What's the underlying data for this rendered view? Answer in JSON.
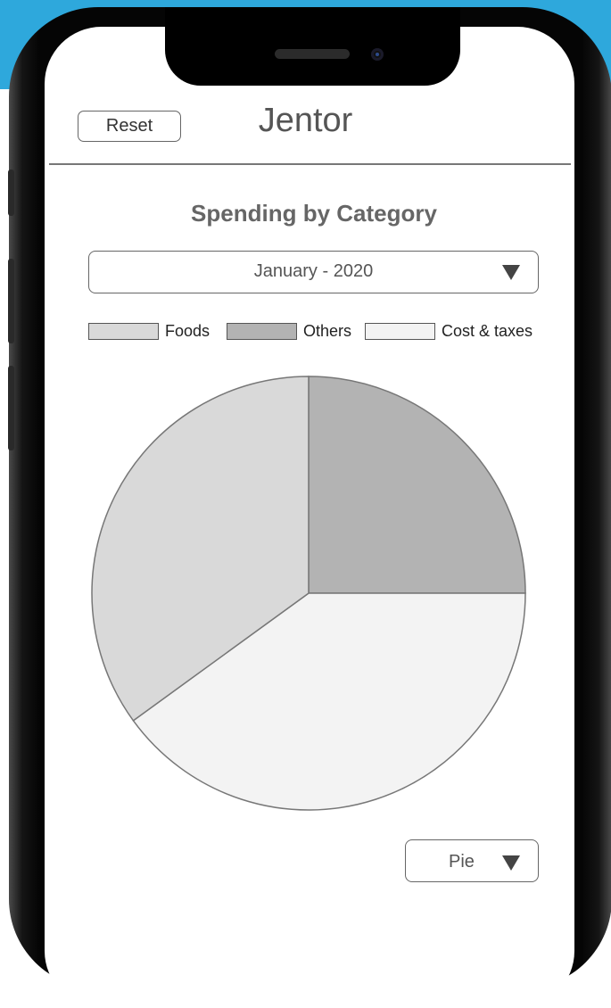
{
  "header": {
    "reset_label": "Reset",
    "app_title": "Jentor"
  },
  "chart_title": "Spending by Category",
  "month_select": {
    "value": "January - 2020",
    "arrow_icon": "triangle-down-icon"
  },
  "legend": [
    {
      "label": "Foods",
      "color": "#d9d9d9"
    },
    {
      "label": "Others",
      "color": "#b3b3b3"
    },
    {
      "label": "Cost & taxes",
      "color": "#f3f3f3"
    }
  ],
  "chart_type_select": {
    "value": "Pie",
    "arrow_icon": "triangle-down-icon"
  },
  "chart_data": {
    "type": "pie",
    "title": "Spending by Category",
    "categories": [
      "Others",
      "Cost & taxes",
      "Foods"
    ],
    "values": [
      25,
      40,
      35
    ],
    "colors": [
      "#b3b3b3",
      "#f3f3f3",
      "#d9d9d9"
    ]
  }
}
